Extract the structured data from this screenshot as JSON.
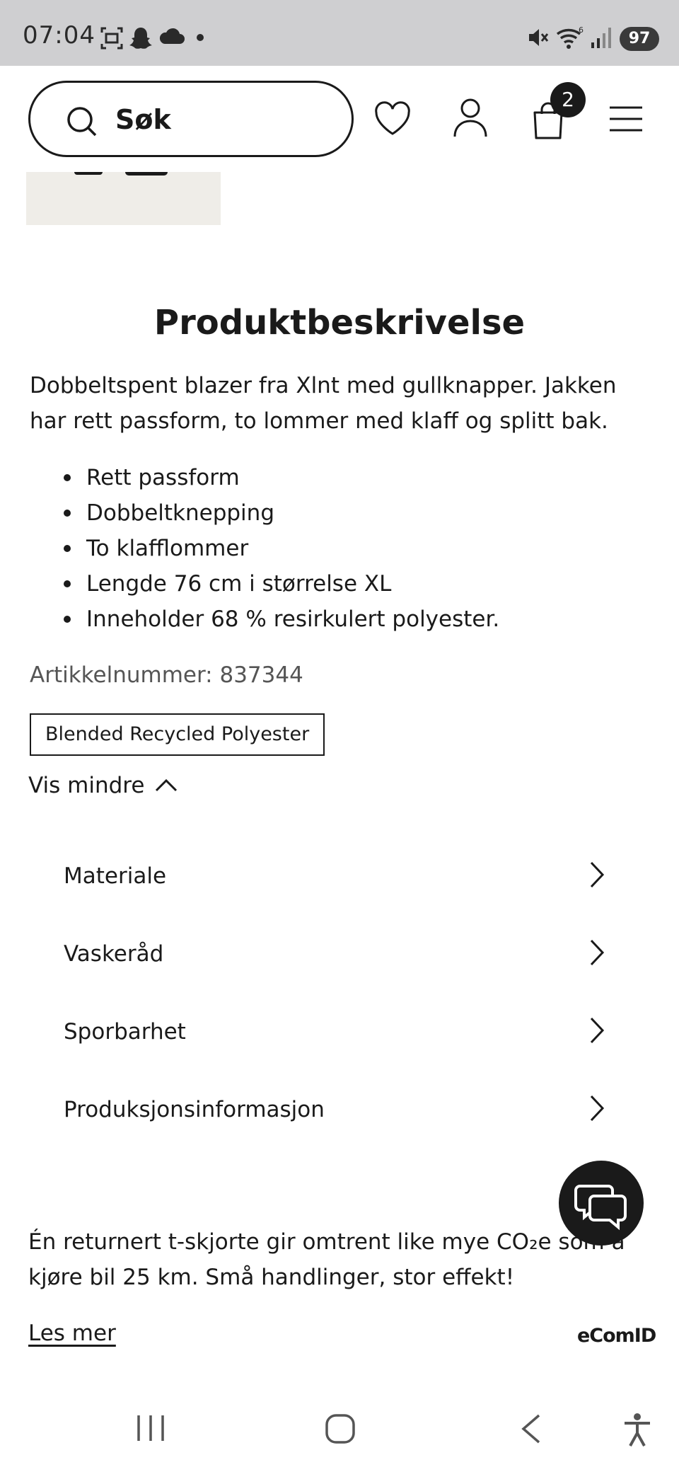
{
  "status_bar": {
    "time": "07:04",
    "battery": "97",
    "icons": [
      "screenshot-icon",
      "snapchat-icon",
      "cloud-icon",
      "dot-icon",
      "mute-icon",
      "wifi-icon",
      "signal-icon",
      "battery-icon"
    ]
  },
  "header": {
    "search_label": "Søk",
    "cart_count": "2",
    "icons": [
      "search-icon",
      "heart-icon",
      "user-icon",
      "bag-icon",
      "menu-icon"
    ]
  },
  "product": {
    "section_title": "Produktbeskrivelse",
    "description": "Dobbeltspent blazer fra Xlnt med gullknapper. Jakken har rett passform, to lommer med klaff og splitt bak.",
    "bullets": [
      "Rett passform",
      "Dobbeltknepping",
      "To klafflommer",
      "Lengde 76 cm i størrelse XL",
      "Inneholder 68 % resirkulert polyester."
    ],
    "article_number": "Artikkelnummer: 837344",
    "tag": "Blended Recycled Polyester",
    "show_less": "Vis mindre"
  },
  "accordion": [
    {
      "label": "Materiale"
    },
    {
      "label": "Vaskeråd"
    },
    {
      "label": "Sporbarhet"
    },
    {
      "label": "Produksjonsinformasjon"
    }
  ],
  "footer": {
    "co2_text": "Én returnert t-skjorte gir omtrent like mye CO₂e som å kjøre bil 25 km. Små handlinger, stor effekt!",
    "read_more": "Les mer",
    "brand": "eComID"
  },
  "colors": {
    "status_bar_bg": "#cfcfd1",
    "text": "#1a1a1a",
    "secondary_text": "#555555",
    "image_bg": "#efede8"
  }
}
